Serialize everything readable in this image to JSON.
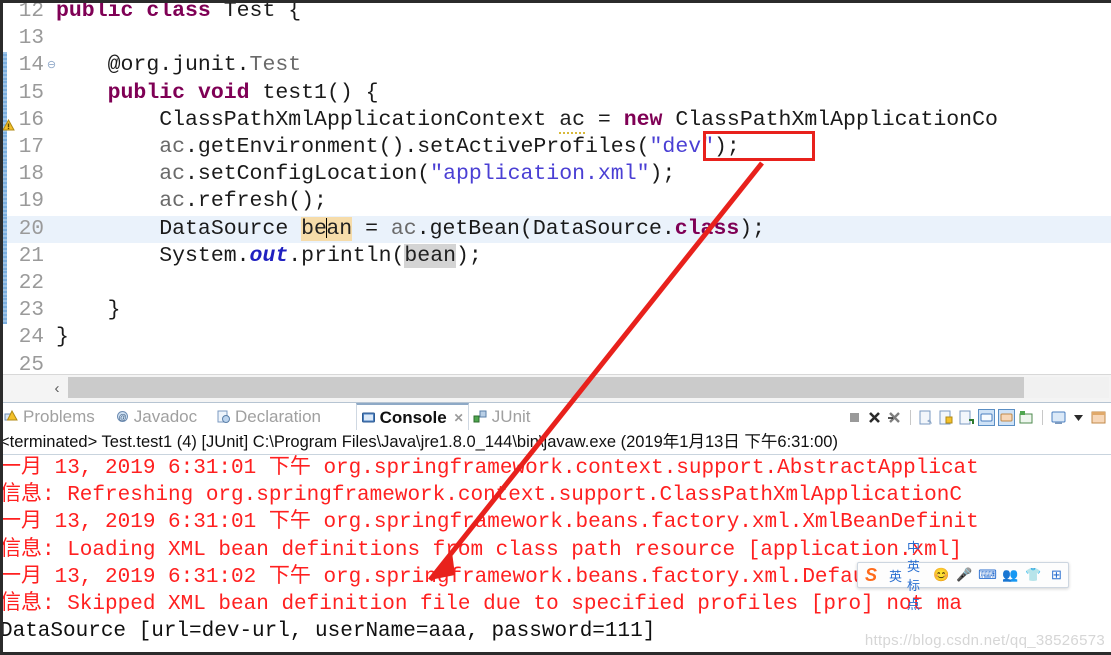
{
  "editor": {
    "lines": [
      {
        "num": "12",
        "fold": false,
        "changed": false,
        "warn": false,
        "current": false,
        "indent": 0,
        "tokens": [
          {
            "t": "public ",
            "c": "kw"
          },
          {
            "t": "class ",
            "c": "kw"
          },
          {
            "t": "Test {",
            "c": "plain"
          }
        ]
      },
      {
        "num": "13",
        "fold": false,
        "changed": false,
        "warn": false,
        "current": false,
        "indent": 0,
        "tokens": []
      },
      {
        "num": "14",
        "fold": true,
        "changed": true,
        "warn": false,
        "current": false,
        "indent": 0,
        "tokens": [
          {
            "t": "    @org.junit.",
            "c": "plain"
          },
          {
            "t": "Test",
            "c": "ident"
          }
        ]
      },
      {
        "num": "15",
        "fold": false,
        "changed": true,
        "warn": false,
        "current": false,
        "indent": 0,
        "tokens": [
          {
            "t": "    ",
            "c": "plain"
          },
          {
            "t": "public ",
            "c": "kw"
          },
          {
            "t": "void ",
            "c": "kw"
          },
          {
            "t": "test1() {",
            "c": "plain"
          }
        ]
      },
      {
        "num": "16",
        "fold": false,
        "changed": true,
        "warn": true,
        "current": false,
        "indent": 0,
        "tokens": [
          {
            "t": "        ClassPathXmlApplicationContext ",
            "c": "plain"
          },
          {
            "t": "ac",
            "c": "squig"
          },
          {
            "t": " = ",
            "c": "plain"
          },
          {
            "t": "new ",
            "c": "kw"
          },
          {
            "t": "ClassPathXmlApplicationCo",
            "c": "plain"
          }
        ]
      },
      {
        "num": "17",
        "fold": false,
        "changed": true,
        "warn": false,
        "current": false,
        "indent": 0,
        "tokens": [
          {
            "t": "        ",
            "c": "plain"
          },
          {
            "t": "ac",
            "c": "ident"
          },
          {
            "t": ".getEnvironment().setActiveProfiles(",
            "c": "plain"
          },
          {
            "t": "\"dev\"",
            "c": "str"
          },
          {
            "t": ");",
            "c": "plain"
          }
        ]
      },
      {
        "num": "18",
        "fold": false,
        "changed": true,
        "warn": false,
        "current": false,
        "indent": 0,
        "tokens": [
          {
            "t": "        ",
            "c": "plain"
          },
          {
            "t": "ac",
            "c": "ident"
          },
          {
            "t": ".setConfigLocation(",
            "c": "plain"
          },
          {
            "t": "\"application.xml\"",
            "c": "str"
          },
          {
            "t": ");",
            "c": "plain"
          }
        ]
      },
      {
        "num": "19",
        "fold": false,
        "changed": true,
        "warn": false,
        "current": false,
        "indent": 0,
        "tokens": [
          {
            "t": "        ",
            "c": "plain"
          },
          {
            "t": "ac",
            "c": "ident"
          },
          {
            "t": ".refresh();",
            "c": "plain"
          }
        ]
      },
      {
        "num": "20",
        "fold": false,
        "changed": true,
        "warn": false,
        "current": true,
        "indent": 0,
        "tokens": [
          {
            "t": "        DataSource ",
            "c": "plain"
          },
          {
            "t": "bean",
            "c": "hl-write",
            "caret": 2
          },
          {
            "t": " = ",
            "c": "plain"
          },
          {
            "t": "ac",
            "c": "ident"
          },
          {
            "t": ".getBean(DataSource.",
            "c": "plain"
          },
          {
            "t": "class",
            "c": "kw"
          },
          {
            "t": ");",
            "c": "plain"
          }
        ]
      },
      {
        "num": "21",
        "fold": false,
        "changed": true,
        "warn": false,
        "current": false,
        "indent": 0,
        "tokens": [
          {
            "t": "        System.",
            "c": "plain"
          },
          {
            "t": "out",
            "c": "kw2"
          },
          {
            "t": ".println(",
            "c": "plain"
          },
          {
            "t": "bean",
            "c": "hl-read"
          },
          {
            "t": ");",
            "c": "plain"
          }
        ]
      },
      {
        "num": "22",
        "fold": false,
        "changed": true,
        "warn": false,
        "current": false,
        "indent": 0,
        "tokens": []
      },
      {
        "num": "23",
        "fold": false,
        "changed": true,
        "warn": false,
        "current": false,
        "indent": 0,
        "tokens": [
          {
            "t": "    }",
            "c": "plain"
          }
        ]
      },
      {
        "num": "24",
        "fold": false,
        "changed": false,
        "warn": false,
        "current": false,
        "indent": 0,
        "tokens": [
          {
            "t": "}",
            "c": "plain"
          }
        ]
      },
      {
        "num": "25",
        "fold": false,
        "changed": false,
        "warn": false,
        "current": false,
        "indent": 0,
        "tokens": []
      }
    ],
    "scrollbar": {
      "left_button": "‹"
    }
  },
  "panel": {
    "tabs": [
      {
        "label": "Problems",
        "icon": "problems-icon",
        "active": false,
        "closable": false
      },
      {
        "label": "Javadoc",
        "icon": "javadoc-icon",
        "active": false,
        "closable": false
      },
      {
        "label": "Declaration",
        "icon": "declaration-icon",
        "active": false,
        "closable": false
      },
      {
        "label": "Console",
        "icon": "console-icon",
        "active": true,
        "closable": true
      },
      {
        "label": "JUnit",
        "icon": "junit-icon",
        "active": false,
        "closable": false
      }
    ],
    "close_glyph": "✕",
    "toolbar_icons": [
      "terminate-icon",
      "terminate-all-icon",
      "remove-all-terminated-icon",
      "clear-console-icon",
      "scroll-lock-icon",
      "show-console-on-output-icon",
      "pin-console-icon",
      "display-selected-console-icon",
      "open-console-icon",
      "new-console-view-icon",
      "view-menu-icon",
      "minimize-icon"
    ],
    "status": "<terminated> Test.test1 (4) [JUnit] C:\\Program Files\\Java\\jre1.8.0_144\\bin\\javaw.exe (2019年1月13日 下午6:31:00)",
    "console_lines": [
      {
        "stream": "err",
        "text": "一月 13, 2019 6:31:01 下午 org.springframework.context.support.AbstractApplicat"
      },
      {
        "stream": "err",
        "text": "信息: Refreshing org.springframework.context.support.ClassPathXmlApplicationC"
      },
      {
        "stream": "err",
        "text": "一月 13, 2019 6:31:01 下午 org.springframework.beans.factory.xml.XmlBeanDefinit"
      },
      {
        "stream": "err",
        "text": "信息: Loading XML bean definitions from class path resource [application.xml]"
      },
      {
        "stream": "err",
        "text": "一月 13, 2019 6:31:02 下午 org.springframework.beans.factory.xml.DefaultBeanDef"
      },
      {
        "stream": "err",
        "text": "信息: Skipped XML bean definition file due to specified profiles [pro] not ma"
      },
      {
        "stream": "out",
        "text": "DataSource [url=dev-url, userName=aaa, password=111]"
      }
    ]
  },
  "annotation": {
    "box_label": "highlight-dev-profile",
    "arrow_label": "arrow-dev-to-console",
    "color": "#e8211c"
  },
  "ime": {
    "logo": "S",
    "items": [
      "英",
      "中英标点",
      "😊",
      "🎤",
      "⌨",
      "👥",
      "👕",
      "⊞"
    ]
  },
  "watermark": "https://blog.csdn.net/qq_38526573",
  "colors": {
    "keyword": "#7f0055",
    "string": "#4a3fd4",
    "stderr": "#ff2020",
    "current_line": "#eaf2fb",
    "annotation_red": "#e8211c"
  }
}
